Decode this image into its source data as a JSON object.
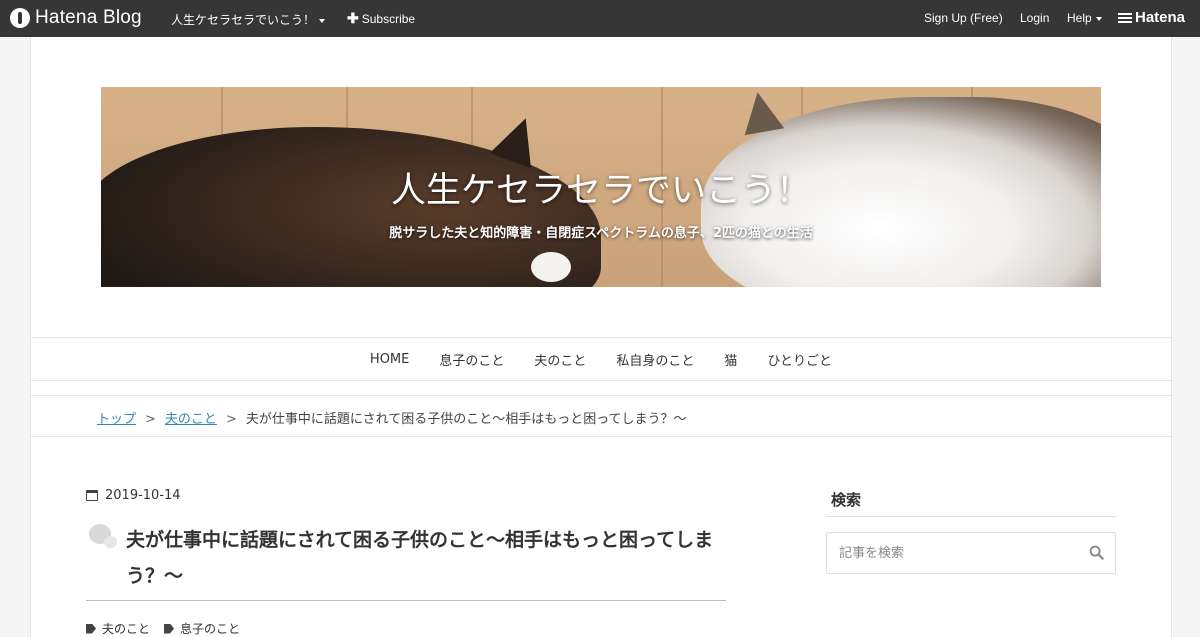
{
  "topbar": {
    "brand": "Hatena Blog",
    "blog_name": "人生ケセラセラでいこう！",
    "subscribe": "Subscribe",
    "signup": "Sign Up (Free)",
    "login": "Login",
    "help": "Help",
    "hatena": "Hatena"
  },
  "header": {
    "title": "人生ケセラセラでいこう！",
    "description": "脱サラした夫と知的障害・自閉症スペクトラムの息子、2匹の猫との生活"
  },
  "nav": {
    "items": [
      "HOME",
      "息子のこと",
      "夫のこと",
      "私自身のこと",
      "猫",
      "ひとりごと"
    ]
  },
  "breadcrumb": {
    "top": "トップ",
    "category": "夫のこと",
    "current": "夫が仕事中に話題にされて困る子供のこと～相手はもっと困ってしまう？～",
    "separator": ">"
  },
  "entry": {
    "date": "2019-10-14",
    "title": "夫が仕事中に話題にされて困る子供のこと～相手はもっと困ってしまう？～",
    "categories": [
      "夫のこと",
      "息子のこと"
    ]
  },
  "sidebar": {
    "search_title": "検索",
    "search_placeholder": "記事を検索"
  },
  "icons": {
    "calendar": "calendar-icon",
    "search": "search-icon",
    "tag": "tag-icon"
  },
  "colors": {
    "topbar_bg": "#363636",
    "link": "#2d8ab7"
  }
}
